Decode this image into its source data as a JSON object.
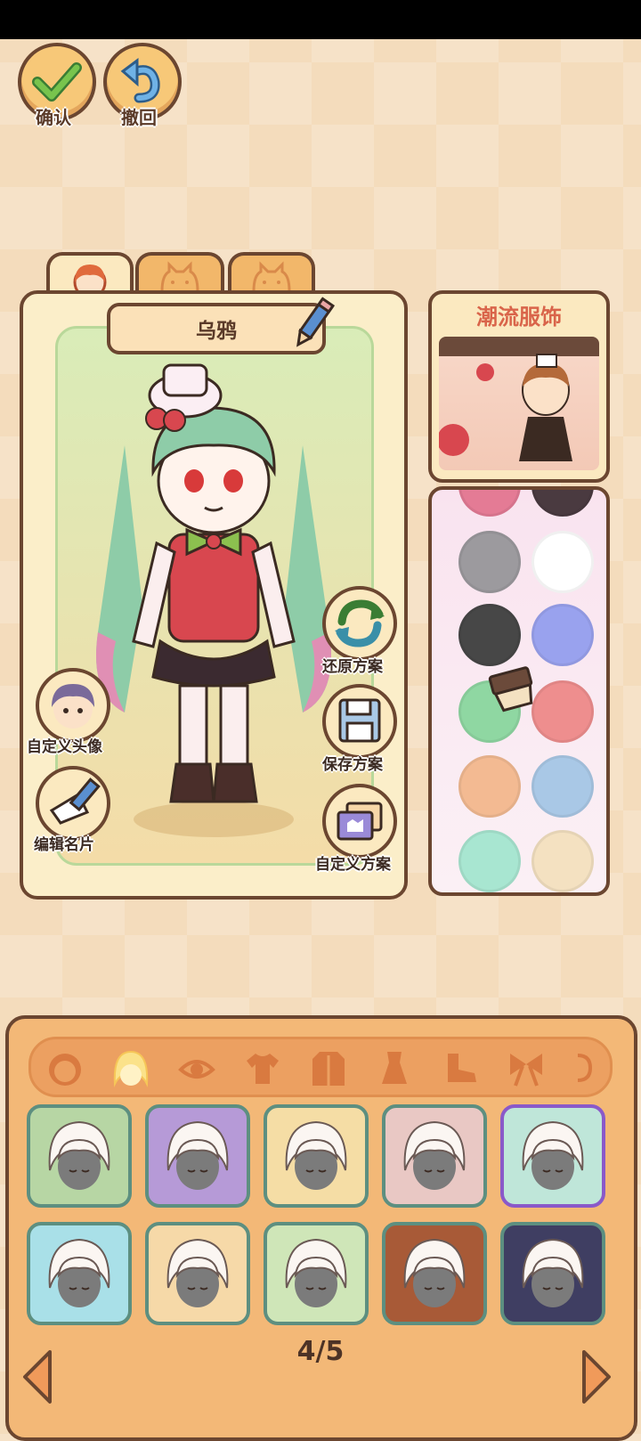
{
  "topbar": {
    "confirm_label": "确认",
    "undo_label": "撤回"
  },
  "tabs": [
    {
      "icon": "girl-face-icon",
      "active": true
    },
    {
      "icon": "cat-face-icon",
      "active": false
    },
    {
      "icon": "cat-face-icon",
      "active": false
    }
  ],
  "character": {
    "name": "乌鸦"
  },
  "actions": {
    "custom_avatar": "自定义头像",
    "edit_card": "编辑名片",
    "restore_plan": "还原方案",
    "save_plan": "保存方案",
    "custom_plan": "自定义方案"
  },
  "fashion": {
    "title": "潮流服饰"
  },
  "palette": {
    "colors": [
      "#e47b95",
      "#4a3a40",
      "#9c9a9e",
      "#ffffff",
      "#474747",
      "#99a2ee",
      "#8fd7a2",
      "#ee8e8e",
      "#f3ba92",
      "#a9c8e6",
      "#a8e6d1",
      "#f4e1c1"
    ]
  },
  "categories": [
    "face-icon",
    "hair-icon",
    "eye-icon",
    "shirt-icon",
    "coat-icon",
    "dress-icon",
    "shoe-icon",
    "bow-icon"
  ],
  "items": [
    {
      "bg": "#b7d6a4",
      "selected": false
    },
    {
      "bg": "#b69ad7",
      "selected": false
    },
    {
      "bg": "#f5dda5",
      "selected": false
    },
    {
      "bg": "#e9c8c4",
      "selected": false
    },
    {
      "bg": "#bfe6d9",
      "selected": true
    },
    {
      "bg": "#a9e0e8",
      "selected": false
    },
    {
      "bg": "#f6d9a8",
      "selected": false
    },
    {
      "bg": "#cfe6b8",
      "selected": false
    },
    {
      "bg": "#a85a37",
      "selected": false
    },
    {
      "bg": "#3f3e62",
      "selected": false
    }
  ],
  "pagination": {
    "text": "4/5"
  }
}
